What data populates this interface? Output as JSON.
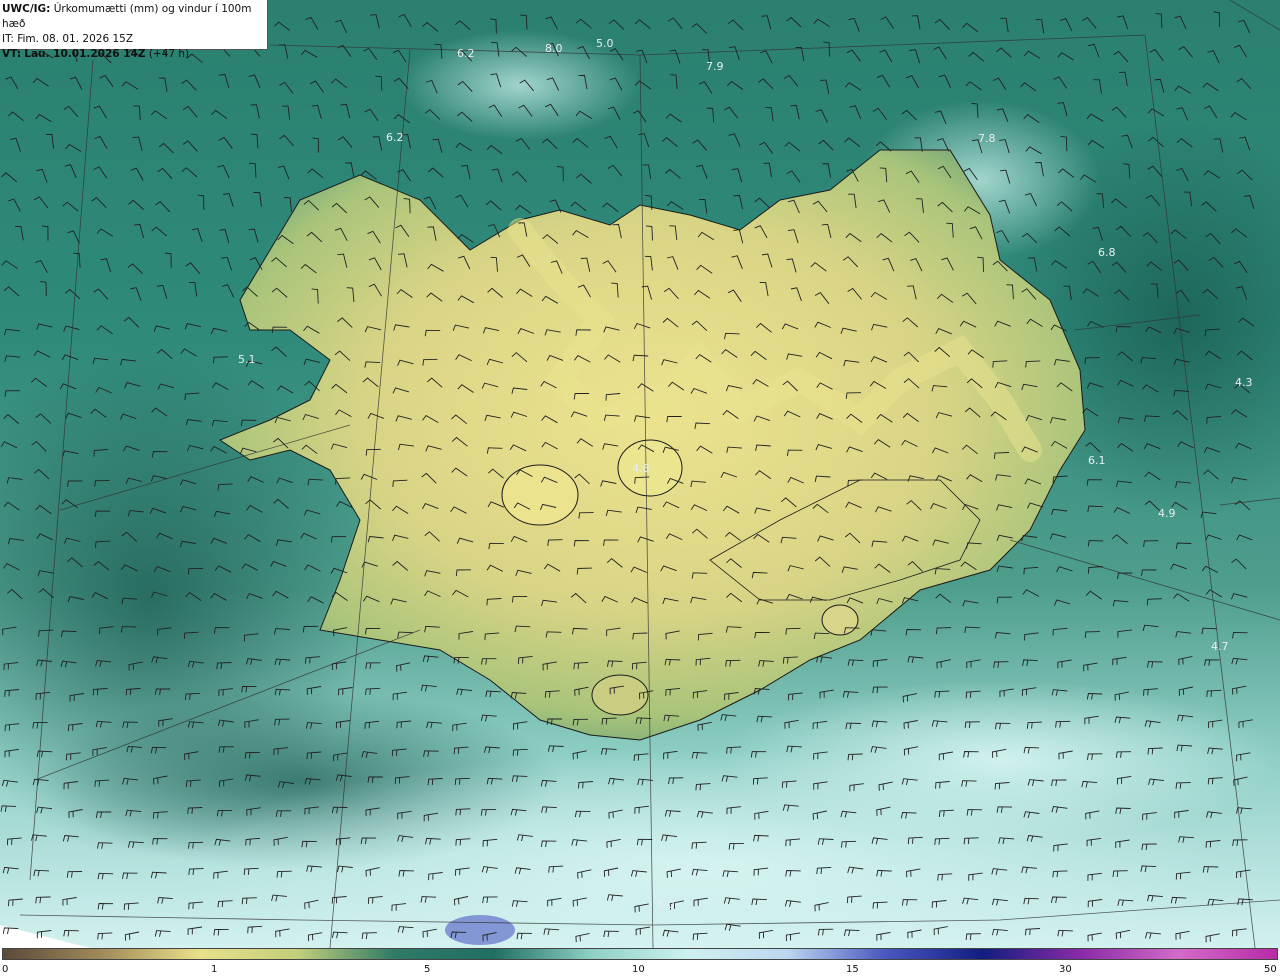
{
  "info": {
    "model": "UWC/IG:",
    "title": "Úrkomumætti (mm) og vindur í 100m hæð",
    "it": "IT: Fim. 08. 01. 2026 15Z",
    "vt_prefix": "VT:",
    "vt_bold": "Lau. 10.01.2026 14Z",
    "vt_suffix": "(+47 h)"
  },
  "legend": {
    "ticks": [
      "0",
      "1",
      "5",
      "10",
      "15",
      "30",
      "50"
    ],
    "colors": [
      "#5a4a3a",
      "#a08a5a",
      "#e9e08a",
      "#c2cf7c",
      "#2e7a66",
      "#1f6f63",
      "#8fd0c4",
      "#cdf1f0",
      "#bcd7f0",
      "#4a58c0",
      "#121d80",
      "#8a2aa8",
      "#d36bc8",
      "#b72aa8"
    ]
  },
  "map_labels": [
    {
      "text": "5.0"
    },
    {
      "text": "8.0"
    },
    {
      "text": "6.2"
    },
    {
      "text": "7.9"
    },
    {
      "text": "7.8"
    },
    {
      "text": "6.8"
    },
    {
      "text": "5.1"
    },
    {
      "text": "4.3"
    },
    {
      "text": "6.1"
    },
    {
      "text": "4.9"
    },
    {
      "text": "4.7"
    },
    {
      "text": "6.2"
    },
    {
      "text": "5.0"
    },
    {
      "text": "4.6"
    }
  ],
  "colors": {
    "ocean_dark": "#1f6f63",
    "ocean_mid": "#2f8a7a",
    "ocean_light": "#9fdcd0",
    "ocean_pale": "#d4f3ef",
    "land_yellow": "#e8e08e",
    "land_green": "#b3c773",
    "land_mid": "#7fae6f"
  }
}
